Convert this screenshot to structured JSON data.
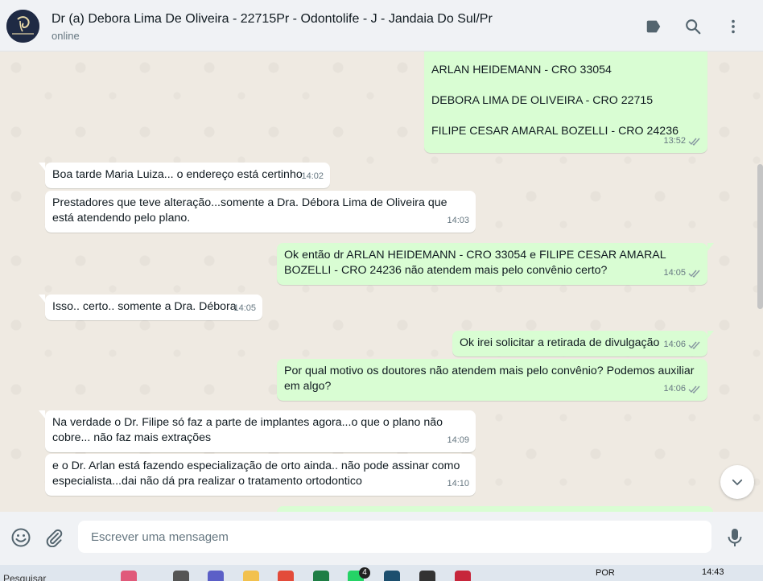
{
  "header": {
    "contact_name": "Dr (a) Debora Lima De Oliveira - 22715Pr - Odontolife - J - Jandaia Do Sul/Pr",
    "status": "online"
  },
  "messages": [
    {
      "dir": "out",
      "lines": [
        "ARLAN HEIDEMANN - CRO 33054",
        "",
        "DEBORA LIMA DE OLIVEIRA - CRO 22715",
        "",
        "FILIPE CESAR AMARAL BOZELLI -  CRO 24236"
      ],
      "time": "13:52",
      "read": true
    },
    {
      "dir": "in",
      "text": "Boa tarde Maria Luiza... o endereço está certinho",
      "time": "14:02"
    },
    {
      "dir": "in",
      "text": "Prestadores que teve alteração...somente a Dra. Débora Lima de Oliveira que está atendendo pelo plano.",
      "time": "14:03"
    },
    {
      "dir": "out",
      "text": "Ok então dr ARLAN HEIDEMANN - CRO 33054 e FILIPE CESAR AMARAL BOZELLI - CRO 24236 não atendem mais pelo convênio certo?",
      "time": "14:05",
      "read": true
    },
    {
      "dir": "in",
      "text": "Isso.. certo.. somente a Dra. Débora",
      "time": "14:05"
    },
    {
      "dir": "out",
      "text": "Ok irei solicitar a retirada de divulgação",
      "time": "14:06",
      "read": true
    },
    {
      "dir": "out",
      "text": "Por qual motivo os doutores não atendem mais pelo convênio? Podemos auxiliar em algo?",
      "time": "14:06",
      "read": true
    },
    {
      "dir": "in",
      "text": "Na verdade o Dr. Filipe só faz a parte de implantes agora...o que o plano não cobre... não faz mais extrações",
      "time": "14:09"
    },
    {
      "dir": "in",
      "text": "e o  Dr. Arlan está fazendo especialização de orto ainda.. não pode assinar como especialista...dai não dá pra realizar o tratamento ortodontico",
      "time": "14:10"
    }
  ],
  "composer": {
    "placeholder": "Escrever uma mensagem"
  },
  "taskbar": {
    "search_label": "Pesquisar",
    "whatsapp_badge": "4",
    "language": "POR",
    "time": "14:43"
  },
  "colors": {
    "incoming_bubble": "#ffffff",
    "outgoing_bubble": "#d9fdd3",
    "chat_background": "#efeae2",
    "read_ticks": "#8696a0"
  }
}
